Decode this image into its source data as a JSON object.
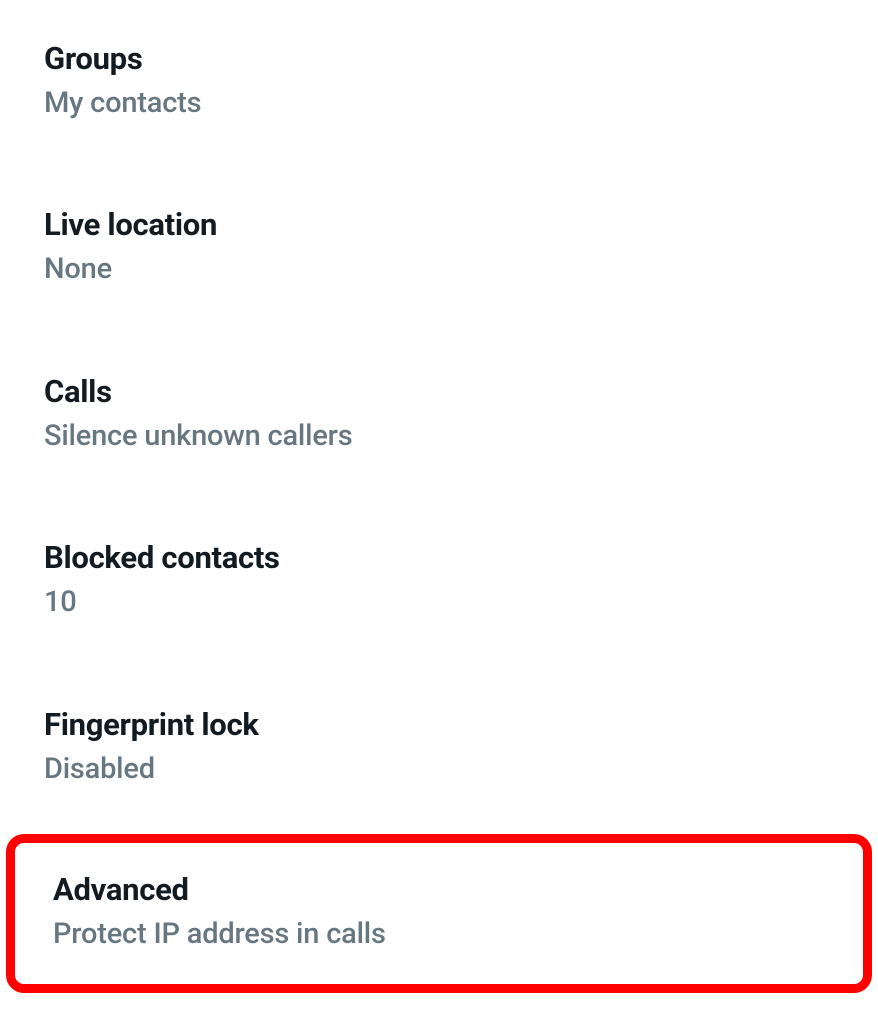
{
  "settings": {
    "items": [
      {
        "title": "Groups",
        "subtitle": "My contacts"
      },
      {
        "title": "Live location",
        "subtitle": "None"
      },
      {
        "title": "Calls",
        "subtitle": "Silence unknown callers"
      },
      {
        "title": "Blocked contacts",
        "subtitle": "10"
      },
      {
        "title": "Fingerprint lock",
        "subtitle": "Disabled"
      },
      {
        "title": "Advanced",
        "subtitle": "Protect IP address in calls"
      }
    ]
  }
}
